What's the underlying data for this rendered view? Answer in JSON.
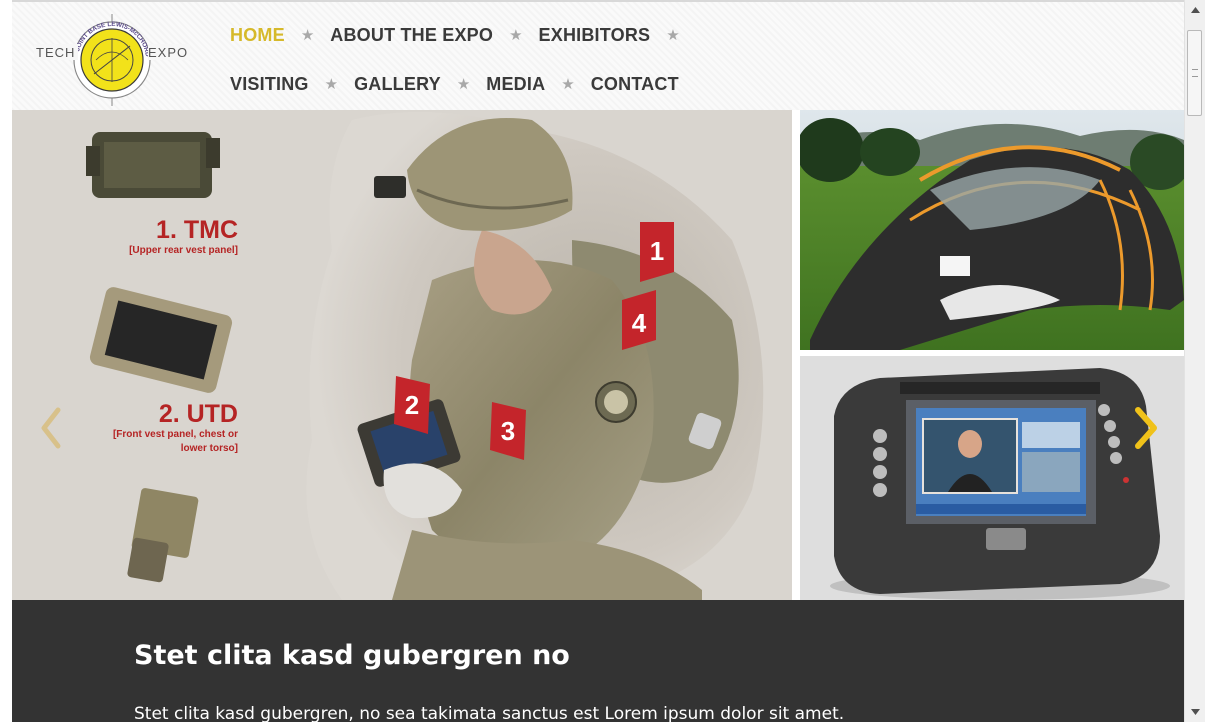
{
  "logo": {
    "left_text": "TECH",
    "right_text": "EXPO",
    "ring_text": "JOINT BASE LEWIS-McCHORD",
    "colors": {
      "yellow": "#f2e21a",
      "ring": "#888888"
    }
  },
  "nav": {
    "row1": [
      {
        "label": "HOME",
        "active": true
      },
      {
        "label": "ABOUT THE EXPO",
        "active": false
      },
      {
        "label": "EXHIBITORS",
        "active": false
      }
    ],
    "row2": [
      {
        "label": "VISITING",
        "active": false
      },
      {
        "label": "GALLERY",
        "active": false
      },
      {
        "label": "MEDIA",
        "active": false
      },
      {
        "label": "CONTACT",
        "active": false
      }
    ],
    "separator": "★"
  },
  "slide": {
    "gear_items": [
      {
        "title": "1. TMC",
        "subtitle": "[Upper rear vest panel]"
      },
      {
        "title": "2. UTD",
        "subtitle_line1": "[Front vest panel, chest or",
        "subtitle_line2": "lower torso]"
      }
    ],
    "markers": [
      "1",
      "4",
      "2",
      "3"
    ]
  },
  "caption": {
    "title": "Stet clita kasd gubergren no",
    "text": "Stet clita kasd gubergren, no sea takimata sanctus est Lorem ipsum dolor sit amet."
  },
  "colors": {
    "accent": "#d6b92a",
    "nav_text": "#3a3a3a",
    "caption_bg": "#333333",
    "marker_red": "#c4252b",
    "gear_title_red": "#b52424"
  },
  "icons": {
    "prev": "chevron-left-icon",
    "next": "chevron-right-icon",
    "nav_separator": "star-icon"
  }
}
